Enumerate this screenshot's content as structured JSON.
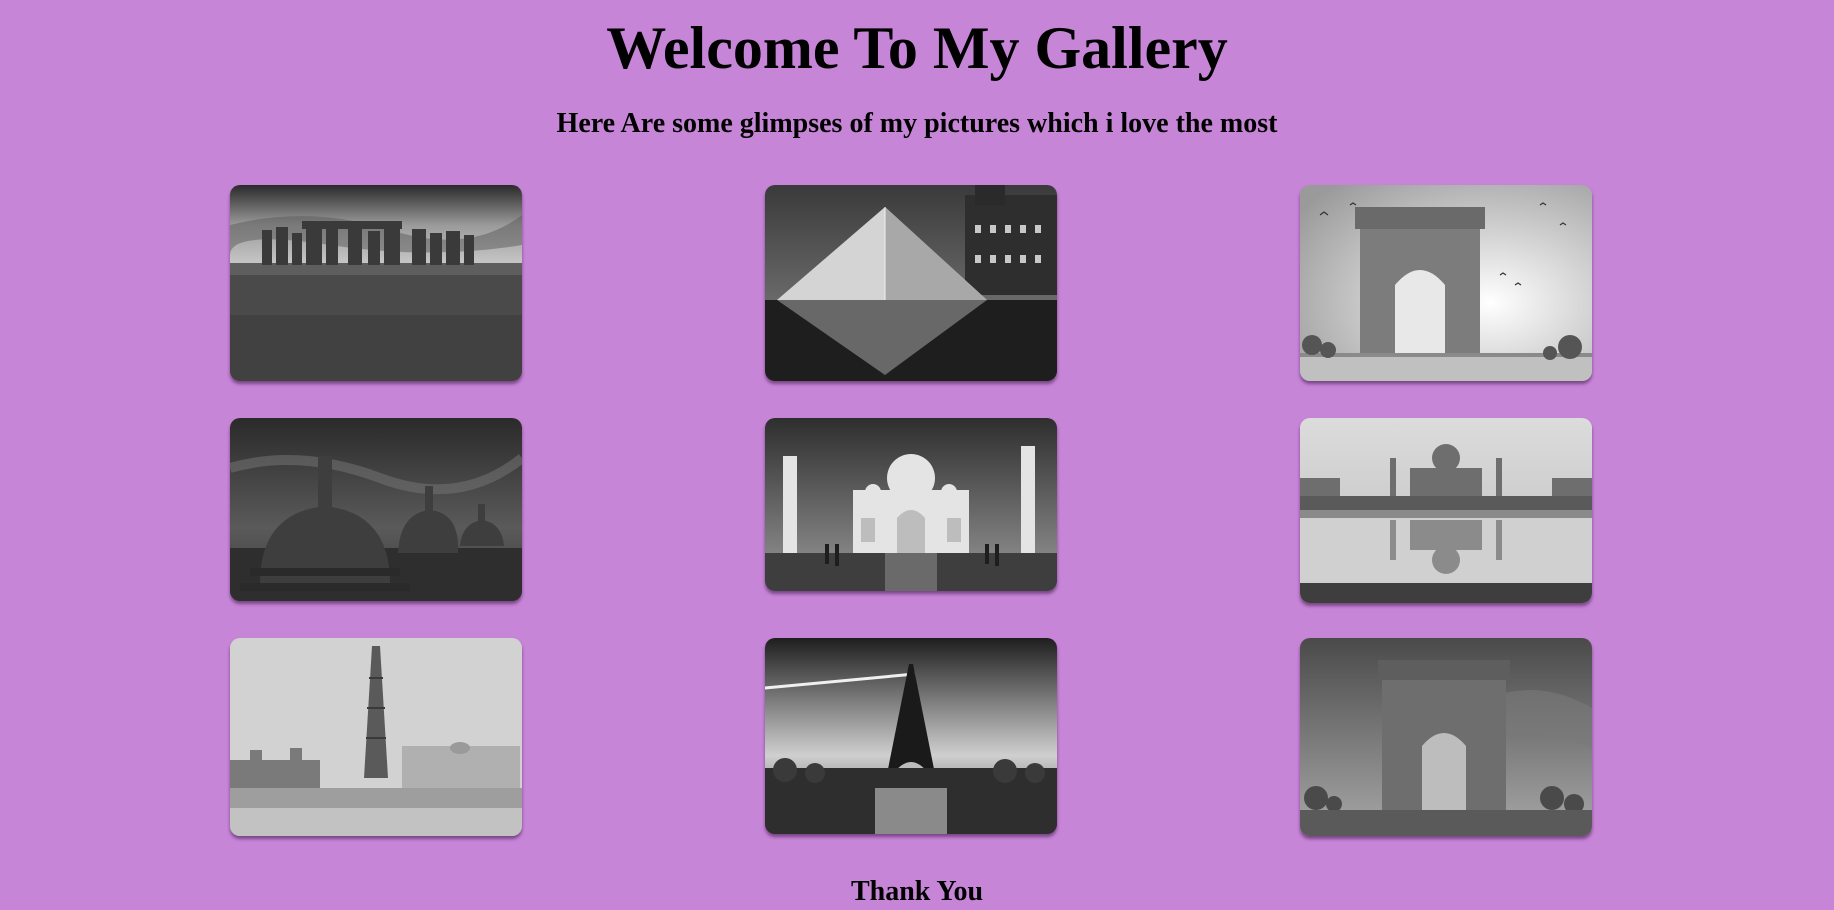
{
  "header": {
    "title": "Welcome To My Gallery",
    "subtitle": "Here Are some glimpses of my pictures which i love the most"
  },
  "gallery": {
    "images": [
      {
        "subject": "Stonehenge"
      },
      {
        "subject": "Louvre Pyramid"
      },
      {
        "subject": "India Gate"
      },
      {
        "subject": "Borobudur stupas"
      },
      {
        "subject": "Taj Mahal"
      },
      {
        "subject": "Taj Mahal reflection"
      },
      {
        "subject": "Qutub Minar"
      },
      {
        "subject": "Eiffel Tower"
      },
      {
        "subject": "India Gate"
      }
    ]
  },
  "footer": {
    "text": "Thank You"
  },
  "colors": {
    "background": "#c785d8",
    "text": "#000000"
  }
}
